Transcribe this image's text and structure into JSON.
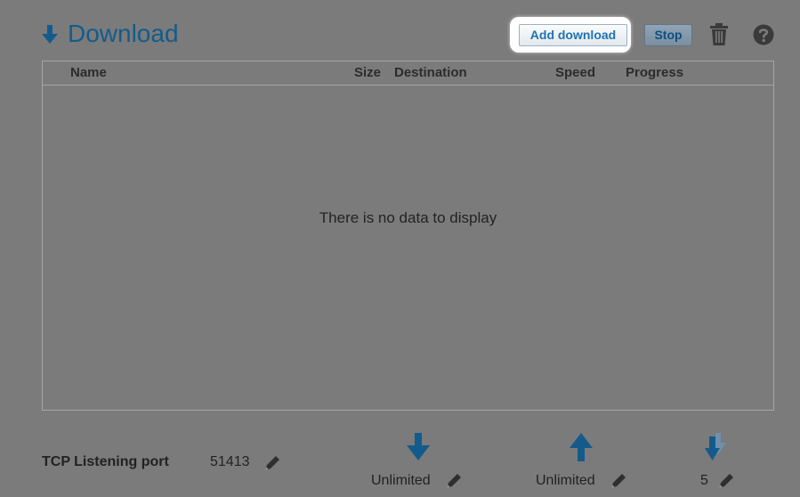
{
  "header": {
    "title": "Download",
    "add_download_label": "Add download",
    "stop_label": "Stop",
    "accent_color": "#145b8c"
  },
  "table": {
    "columns": [
      "Name",
      "Size",
      "Destination",
      "Speed",
      "Progress"
    ],
    "empty_message": "There is no data to display"
  },
  "footer": {
    "tcp_label": "TCP Listening port",
    "tcp_value": "51413",
    "download_limit": "Unlimited",
    "upload_limit": "Unlimited",
    "max_downloads": "5"
  },
  "icons": {
    "header": "download-arrow-icon",
    "trash": "trash-icon",
    "help": "help-icon",
    "edit": "pencil-icon",
    "download_limit": "download-arrow-icon",
    "upload_limit": "upload-arrow-icon",
    "max_downloads": "multi-download-icon"
  }
}
